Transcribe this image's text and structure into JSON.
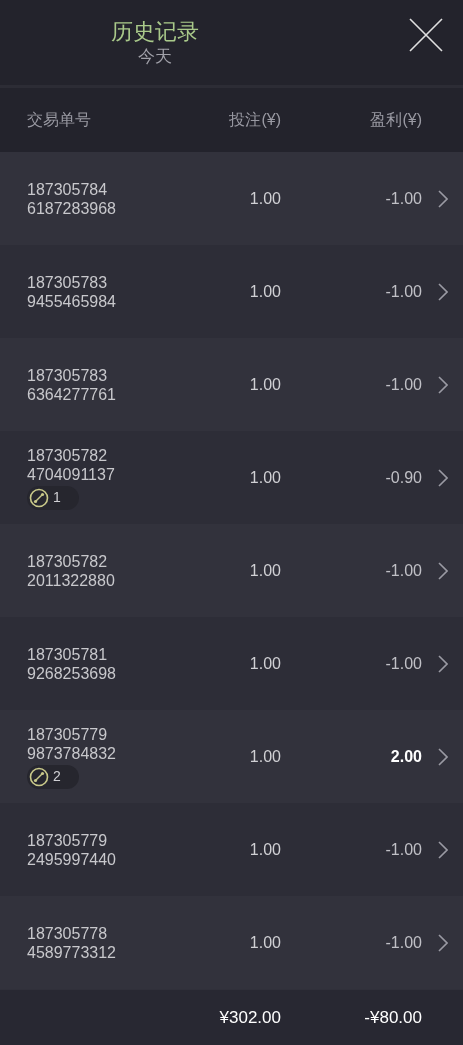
{
  "header": {
    "title": "历史记录",
    "subtitle": "今天"
  },
  "columns": [
    "交易单号",
    "投注(¥)",
    "盈利(¥)"
  ],
  "rows": [
    {
      "id_line1": "187305784",
      "id_line2": "6187283968",
      "stake": "1.00",
      "profit": "-1.00",
      "positive": false
    },
    {
      "id_line1": "187305783",
      "id_line2": "9455465984",
      "stake": "1.00",
      "profit": "-1.00",
      "positive": false
    },
    {
      "id_line1": "187305783",
      "id_line2": "6364277761",
      "stake": "1.00",
      "profit": "-1.00",
      "positive": false
    },
    {
      "id_line1": "187305782",
      "id_line2": "4704091137",
      "badge": "1",
      "stake": "1.00",
      "profit": "-0.90",
      "positive": false
    },
    {
      "id_line1": "187305782",
      "id_line2": "2011322880",
      "stake": "1.00",
      "profit": "-1.00",
      "positive": false
    },
    {
      "id_line1": "187305781",
      "id_line2": "9268253698",
      "stake": "1.00",
      "profit": "-1.00",
      "positive": false
    },
    {
      "id_line1": "187305779",
      "id_line2": "9873784832",
      "badge": "2",
      "stake": "1.00",
      "profit": "2.00",
      "positive": true
    },
    {
      "id_line1": "187305779",
      "id_line2": "2495997440",
      "stake": "1.00",
      "profit": "-1.00",
      "positive": false
    },
    {
      "id_line1": "187305778",
      "id_line2": "4589773312",
      "stake": "1.00",
      "profit": "-1.00",
      "positive": false
    }
  ],
  "totals": {
    "stake": "¥302.00",
    "profit": "-¥80.00"
  }
}
